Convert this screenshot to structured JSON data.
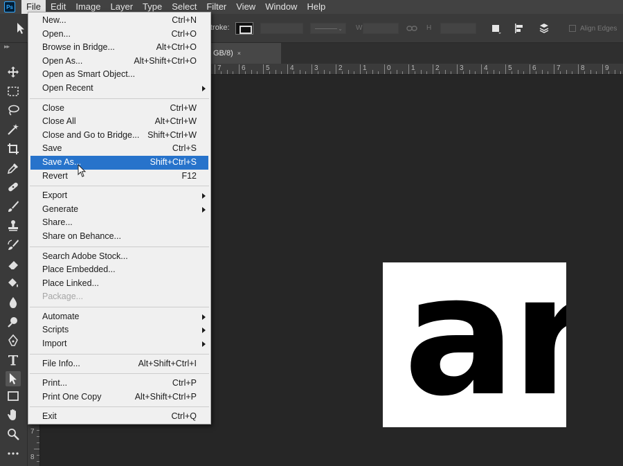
{
  "app": {
    "logo_text": "Ps",
    "menubar": [
      "File",
      "Edit",
      "Image",
      "Layer",
      "Type",
      "Select",
      "Filter",
      "View",
      "Window",
      "Help"
    ],
    "open_menu": "File"
  },
  "options_bar": {
    "stroke_label": "troke:",
    "w_label": "W",
    "h_label": "H",
    "align_edges_label": "Align Edges"
  },
  "document_tab": {
    "title_fragment": "GB/8)",
    "close_glyph": "×"
  },
  "ruler_top": [
    "7",
    "6",
    "5",
    "4",
    "3",
    "2",
    "1",
    "0",
    "1",
    "2",
    "3",
    "4",
    "5",
    "6",
    "7",
    "8",
    "9"
  ],
  "ruler_left": [
    "7",
    "8"
  ],
  "canvas": {
    "document_text": "ar",
    "background_color": "#262626",
    "document_color": "#ffffff"
  },
  "file_menu": {
    "items": [
      {
        "label": "New...",
        "shortcut": "Ctrl+N"
      },
      {
        "label": "Open...",
        "shortcut": "Ctrl+O"
      },
      {
        "label": "Browse in Bridge...",
        "shortcut": "Alt+Ctrl+O"
      },
      {
        "label": "Open As...",
        "shortcut": "Alt+Shift+Ctrl+O"
      },
      {
        "label": "Open as Smart Object...",
        "shortcut": ""
      },
      {
        "label": "Open Recent",
        "shortcut": "",
        "submenu": true
      },
      {
        "separator": true
      },
      {
        "label": "Close",
        "shortcut": "Ctrl+W"
      },
      {
        "label": "Close All",
        "shortcut": "Alt+Ctrl+W"
      },
      {
        "label": "Close and Go to Bridge...",
        "shortcut": "Shift+Ctrl+W"
      },
      {
        "label": "Save",
        "shortcut": "Ctrl+S"
      },
      {
        "label": "Save As...",
        "shortcut": "Shift+Ctrl+S",
        "highlighted": true
      },
      {
        "label": "Revert",
        "shortcut": "F12"
      },
      {
        "separator": true
      },
      {
        "label": "Export",
        "shortcut": "",
        "submenu": true
      },
      {
        "label": "Generate",
        "shortcut": "",
        "submenu": true
      },
      {
        "label": "Share...",
        "shortcut": ""
      },
      {
        "label": "Share on Behance...",
        "shortcut": ""
      },
      {
        "separator": true
      },
      {
        "label": "Search Adobe Stock...",
        "shortcut": ""
      },
      {
        "label": "Place Embedded...",
        "shortcut": ""
      },
      {
        "label": "Place Linked...",
        "shortcut": ""
      },
      {
        "label": "Package...",
        "shortcut": "",
        "disabled": true
      },
      {
        "separator": true
      },
      {
        "label": "Automate",
        "shortcut": "",
        "submenu": true
      },
      {
        "label": "Scripts",
        "shortcut": "",
        "submenu": true
      },
      {
        "label": "Import",
        "shortcut": "",
        "submenu": true
      },
      {
        "separator": true
      },
      {
        "label": "File Info...",
        "shortcut": "Alt+Shift+Ctrl+I"
      },
      {
        "separator": true
      },
      {
        "label": "Print...",
        "shortcut": "Ctrl+P"
      },
      {
        "label": "Print One Copy",
        "shortcut": "Alt+Shift+Ctrl+P"
      },
      {
        "separator": true
      },
      {
        "label": "Exit",
        "shortcut": "Ctrl+Q"
      }
    ]
  },
  "toolbar": {
    "tools": [
      "move-icon",
      "marquee-icon",
      "lasso-icon",
      "magic-wand-icon",
      "crop-icon",
      "eyedropper-icon",
      "healing-brush-icon",
      "brush-icon",
      "clone-stamp-icon",
      "history-brush-icon",
      "eraser-icon",
      "paint-bucket-icon",
      "blur-icon",
      "dodge-icon",
      "pen-icon",
      "type-icon",
      "path-selection-icon",
      "rectangle-icon",
      "hand-icon",
      "zoom-icon",
      "more-tools-icon"
    ],
    "active_tool": "path-selection-icon"
  },
  "colors": {
    "menu_highlight": "#2773cb",
    "menubar_bg": "#424242",
    "panel_bg": "#3a3a3a",
    "menu_bg": "#f0f0f0"
  }
}
